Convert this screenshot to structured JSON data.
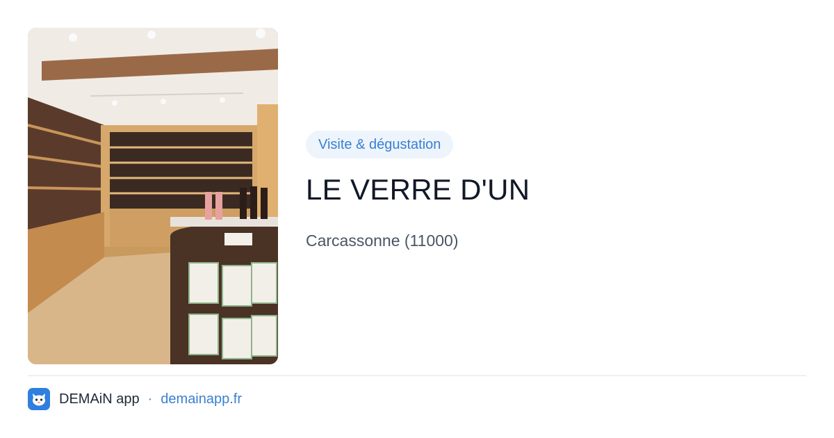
{
  "photo": {
    "icon": "wine-shop-interior-photo",
    "colors": {
      "wood": "#c8955a",
      "floor": "#d9b98e",
      "ceiling": "#f2ece6",
      "beam": "#9a6a48"
    }
  },
  "badge": {
    "label": "Visite & dégustation"
  },
  "listing": {
    "title": "LE VERRE D'UN",
    "location": "Carcassonne (11000)"
  },
  "footer": {
    "app_icon": "cat-face-icon",
    "app_name": "DEMAiN app",
    "separator": "·",
    "domain": "demainapp.fr"
  },
  "colors": {
    "accent": "#3a7fd0",
    "badge_bg": "#edf4fc",
    "title": "#111827",
    "muted": "#4b5563",
    "divider": "#dde3ea"
  }
}
